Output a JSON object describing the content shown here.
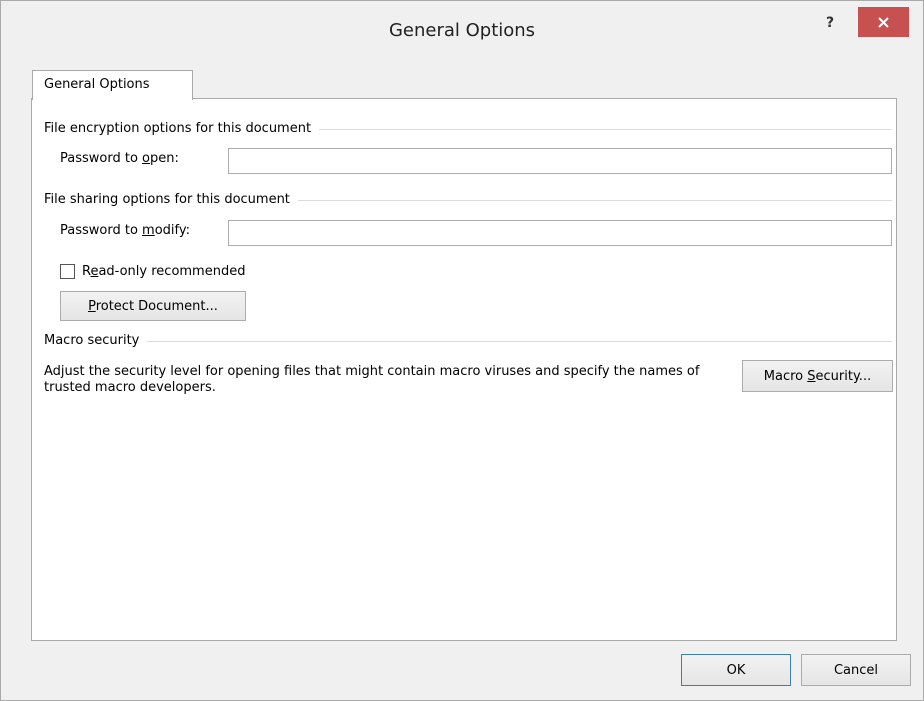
{
  "window": {
    "title": "General Options",
    "help_label": "?",
    "close_icon": "close-icon"
  },
  "tab": {
    "label": "General Options"
  },
  "encryption": {
    "group_title": "File encryption options for this document",
    "password_open_label_pre": "Password to ",
    "password_open_label_key": "o",
    "password_open_label_post": "pen:",
    "password_open_value": ""
  },
  "sharing": {
    "group_title": "File sharing options for this document",
    "password_modify_label_pre": "Password to ",
    "password_modify_label_key": "m",
    "password_modify_label_post": "odify:",
    "password_modify_value": "",
    "readonly_label_pre": "R",
    "readonly_label_key": "e",
    "readonly_label_post": "ad-only recommended",
    "readonly_checked": false,
    "protect_button_key": "P",
    "protect_button_post": "rotect Document..."
  },
  "macro": {
    "group_title": "Macro security",
    "description": "Adjust the security level for opening files that might contain macro viruses and specify the names of trusted macro developers.",
    "button_pre": "Macro ",
    "button_key": "S",
    "button_post": "ecurity..."
  },
  "footer": {
    "ok_label": "OK",
    "cancel_label": "Cancel"
  },
  "colors": {
    "close_button": "#c75050",
    "default_button_border": "#3c7fb1"
  }
}
